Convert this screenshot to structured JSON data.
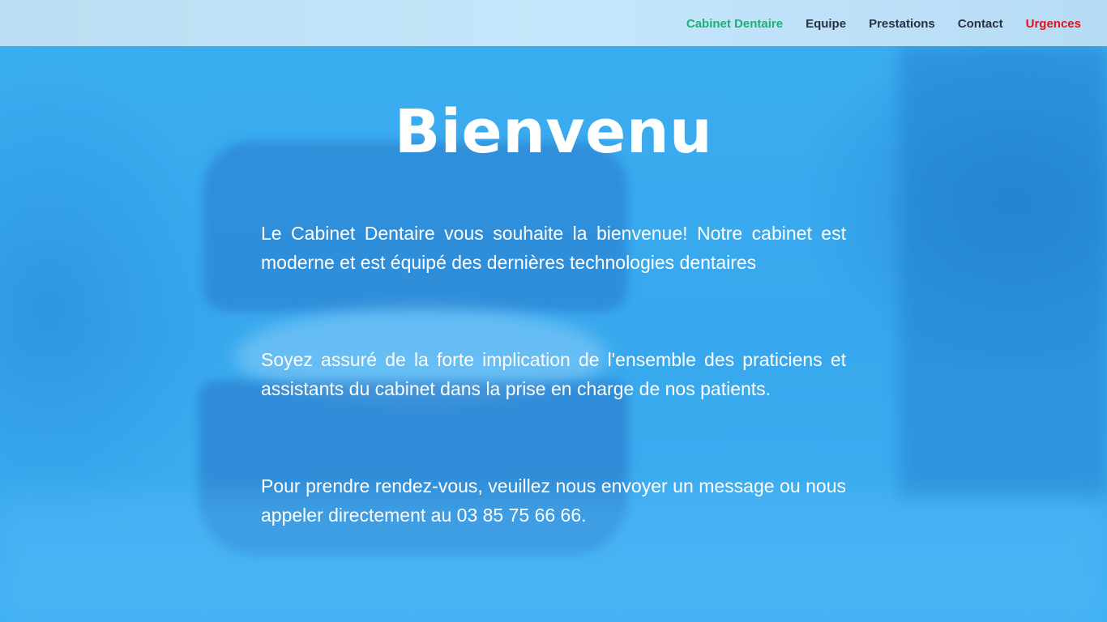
{
  "nav": {
    "items": [
      {
        "label": "Cabinet Dentaire",
        "state": "active"
      },
      {
        "label": "Equipe"
      },
      {
        "label": "Prestations"
      },
      {
        "label": "Contact"
      },
      {
        "label": "Urgences",
        "state": "urgent"
      }
    ]
  },
  "hero": {
    "title": "Bienvenu",
    "paragraphs": [
      "Le Cabinet Dentaire vous souhaite la bienvenue! Notre cabinet est moderne et est équipé des dernières technologies dentaires",
      "Soyez assuré de la forte implication de l'ensemble des praticiens et assistants du cabinet dans la prise en charge de nos patients.",
      "Pour prendre rendez-vous, veuillez nous envoyer un message ou nous appeler directement au 03 85 75 66 66."
    ]
  },
  "colors": {
    "overlay_blue": "#3aa9ee",
    "nav_active": "#19b276",
    "nav_default": "#2a3142",
    "nav_urgent": "#e8101a"
  }
}
